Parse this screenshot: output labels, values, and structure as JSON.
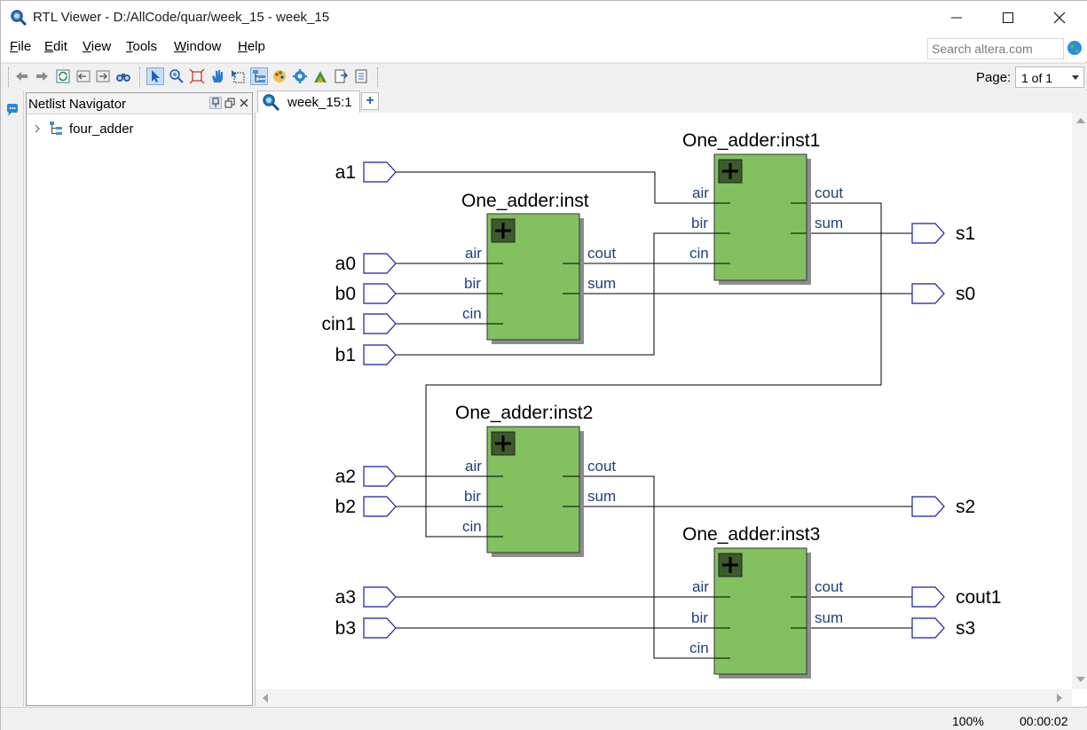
{
  "window": {
    "title": "RTL Viewer - D:/AllCode/quar/week_15 - week_15"
  },
  "menu": {
    "items": [
      {
        "key": "F",
        "rest": "ile"
      },
      {
        "key": "E",
        "rest": "dit"
      },
      {
        "key": "V",
        "rest": "iew"
      },
      {
        "key": "T",
        "rest": "ools"
      },
      {
        "key": "W",
        "rest": "indow"
      },
      {
        "key": "H",
        "rest": "elp"
      }
    ],
    "search_placeholder": "Search altera.com"
  },
  "toolbar": {
    "page_label": "Page:",
    "page_value": "1 of 1"
  },
  "navigator": {
    "title": "Netlist Navigator",
    "tree": [
      {
        "label": "four_adder"
      }
    ]
  },
  "tabs": [
    {
      "label": "week_15:1"
    }
  ],
  "schematic": {
    "ports": {
      "a1": "a1",
      "a0": "a0",
      "b0": "b0",
      "cin1": "cin1",
      "b1": "b1",
      "a2": "a2",
      "b2": "b2",
      "a3": "a3",
      "b3": "b3",
      "s1": "s1",
      "s0": "s0",
      "s2": "s2",
      "cout1": "cout1",
      "s3": "s3"
    },
    "instances": [
      {
        "name": "One_adder:inst"
      },
      {
        "name": "One_adder:inst1"
      },
      {
        "name": "One_adder:inst2"
      },
      {
        "name": "One_adder:inst3"
      }
    ],
    "pins": {
      "air": "air",
      "bir": "bir",
      "cin": "cin",
      "cout": "cout",
      "sum": "sum"
    },
    "block_color": "#82c060",
    "wire_color": "#000000",
    "port_color": "#1a1aa8"
  },
  "status": {
    "zoom": "100%",
    "time": "00:00:02"
  }
}
